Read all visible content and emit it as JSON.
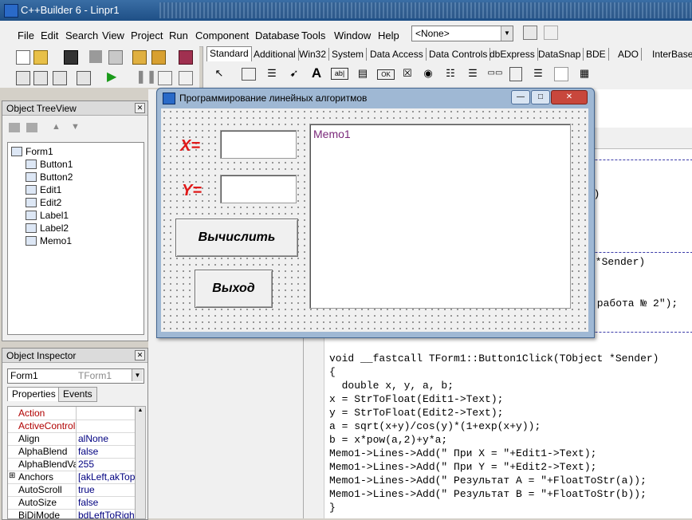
{
  "app": {
    "title": "C++Builder 6 - Linpr1"
  },
  "menu": {
    "items": [
      "File",
      "Edit",
      "Search",
      "View",
      "Project",
      "Run",
      "Component",
      "Database",
      "Tools",
      "Window",
      "Help"
    ],
    "combo_value": "<None>"
  },
  "palette": {
    "tabs": [
      "Standard",
      "Additional",
      "Win32",
      "System",
      "Data Access",
      "Data Controls",
      "dbExpress",
      "DataSnap",
      "BDE",
      "ADO",
      "InterBase"
    ],
    "active": "Standard"
  },
  "tree": {
    "title": "Object TreeView",
    "root": "Form1",
    "children": [
      "Button1",
      "Button2",
      "Edit1",
      "Edit2",
      "Label1",
      "Label2",
      "Memo1"
    ]
  },
  "inspector": {
    "title": "Object Inspector",
    "object": "Form1",
    "object_class": "TForm1",
    "tabs": [
      "Properties",
      "Events"
    ],
    "rows": [
      {
        "name": "Action",
        "value": "",
        "event": true
      },
      {
        "name": "ActiveControl",
        "value": "",
        "event": true
      },
      {
        "name": "Align",
        "value": "alNone",
        "event": false
      },
      {
        "name": "AlphaBlend",
        "value": "false",
        "event": false
      },
      {
        "name": "AlphaBlendValu",
        "value": "255",
        "event": false
      },
      {
        "name": "Anchors",
        "value": "[akLeft,akTop",
        "event": false,
        "expand": "⊞"
      },
      {
        "name": "AutoScroll",
        "value": "true",
        "event": false
      },
      {
        "name": "AutoSize",
        "value": "false",
        "event": false
      },
      {
        "name": "BiDiMode",
        "value": "bdLeftToRight",
        "event": false
      }
    ]
  },
  "form": {
    "title": "Программирование линейных алгоритмов",
    "label_x": "X=",
    "label_y": "Y=",
    "btn_calc": "Вычислить",
    "btn_exit": "Выход",
    "memo": "Memo1",
    "win_buttons": {
      "min": "—",
      "max": "□",
      "close": "✕"
    }
  },
  "editor": {
    "fragments": [
      "er)",
      " *Sender)",
      " работа № 2\");"
    ],
    "lines": [
      "void __fastcall TForm1::Button1Click(TObject *Sender)",
      "{",
      "  double x, y, a, b;",
      "x = StrToFloat(Edit1->Text);",
      "y = StrToFloat(Edit2->Text);",
      "a = sqrt(x+y)/cos(y)*(1+exp(x+y));",
      "b = x*pow(a,2)+y*a;",
      "Memo1->Lines->Add(\" При X = \"+Edit1->Text);",
      "Memo1->Lines->Add(\" При Y = \"+Edit2->Text);",
      "Memo1->Lines->Add(\" Результат A = \"+FloatToStr(a));",
      "Memo1->Lines->Add(\" Результат B = \"+FloatToStr(b));",
      "}"
    ]
  }
}
